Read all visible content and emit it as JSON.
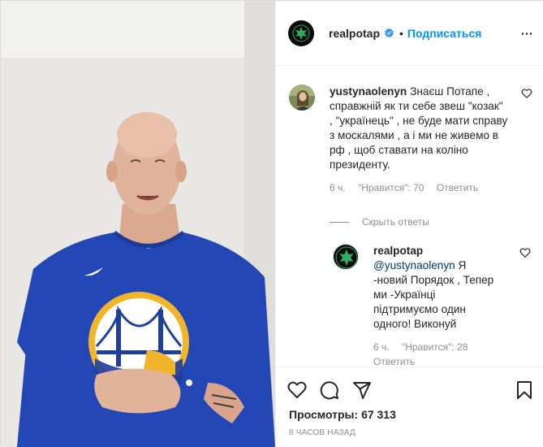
{
  "header": {
    "username": "realpotap",
    "separator": "•",
    "follow_label": "Подписаться",
    "logo_icon": "green-leaf-logo-icon",
    "verified_icon": "verified-badge-icon",
    "more_icon": "more-options-icon"
  },
  "comment": {
    "username": "yustynaolenyn",
    "text": "Знаєш Потапе , справжній як ти себе звеш \"козак\" , \"українець\" , не буде мати справу з москалями , а і ми не живемо в рф , щоб ставати на коліно президенту.",
    "time": "6 ч.",
    "likes": "\"Нравится\": 70",
    "reply_label": "Ответить"
  },
  "hide_replies_label": "Скрыть ответы",
  "reply": {
    "username": "realpotap",
    "mention": "@yustynaolenyn",
    "text": " Я -новий Порядок , Тепер ми -Українці підтримуємо один одного! Виконуй",
    "time": "6 ч.",
    "likes": "\"Нравится\": 28",
    "reply_label": "Ответить"
  },
  "actions": {
    "like_icon": "heart-icon",
    "comment_icon": "comment-icon",
    "share_icon": "share-icon",
    "save_icon": "bookmark-icon",
    "views_label": "Просмотры:",
    "views_value": "67 313",
    "timestamp": "8 ЧАСОВ НАЗАД"
  },
  "colors": {
    "accent": "#0095f6",
    "verified": "#3897f0",
    "logo_green": "#2fae5b",
    "shirt_blue": "#2447b6",
    "logo_gold": "#f1b52a"
  }
}
